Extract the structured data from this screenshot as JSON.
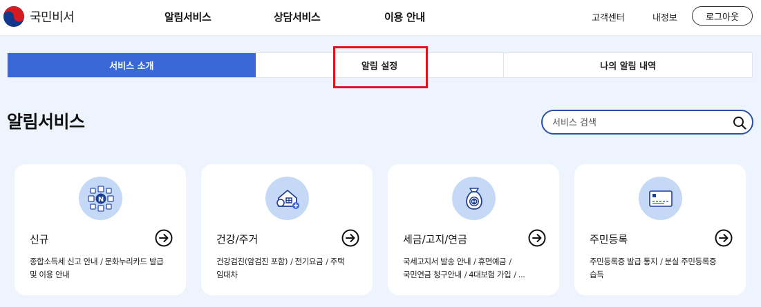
{
  "header": {
    "logo_text": "국민비서",
    "nav": [
      "알림서비스",
      "상담서비스",
      "이용 안내"
    ],
    "util": [
      "고객센터",
      "내정보"
    ],
    "login_label": "로그아웃"
  },
  "tabs": [
    {
      "label": "서비스 소개",
      "active": true
    },
    {
      "label": "알림 설정",
      "active": false
    },
    {
      "label": "나의 알림 내역",
      "active": false
    }
  ],
  "page": {
    "title": "알림서비스",
    "search_placeholder": "서비스 검색"
  },
  "cards": [
    {
      "title": "신규",
      "icon": "compass-network-icon",
      "line1": [
        "종합소득세 신고 안내",
        "문화누리카드 발급"
      ],
      "line2": [
        "및 이용 안내"
      ]
    },
    {
      "title": "건강/주거",
      "icon": "house-health-icon",
      "line1": [
        "건강검진(암검진 포함)",
        "전기요금",
        "주택"
      ],
      "line2": [
        "임대차"
      ]
    },
    {
      "title": "세금/고지/연금",
      "icon": "money-bag-icon",
      "line1": [
        "국세고지서 발송 안내",
        "휴면예금"
      ],
      "line2": [
        "국민연금 청구안내",
        "4대보험 가입",
        "..."
      ]
    },
    {
      "title": "주민등록",
      "icon": "id-card-icon",
      "line1": [
        "주민등록증 발급 통지",
        "분실 주민등록증"
      ],
      "line2": [
        "습득"
      ]
    }
  ],
  "colors": {
    "accent": "#3a68d8",
    "background": "#eef4fd",
    "icon_circle": "#c5d9f7",
    "highlight": "#e0141e",
    "search_border": "#2a4fa8"
  }
}
